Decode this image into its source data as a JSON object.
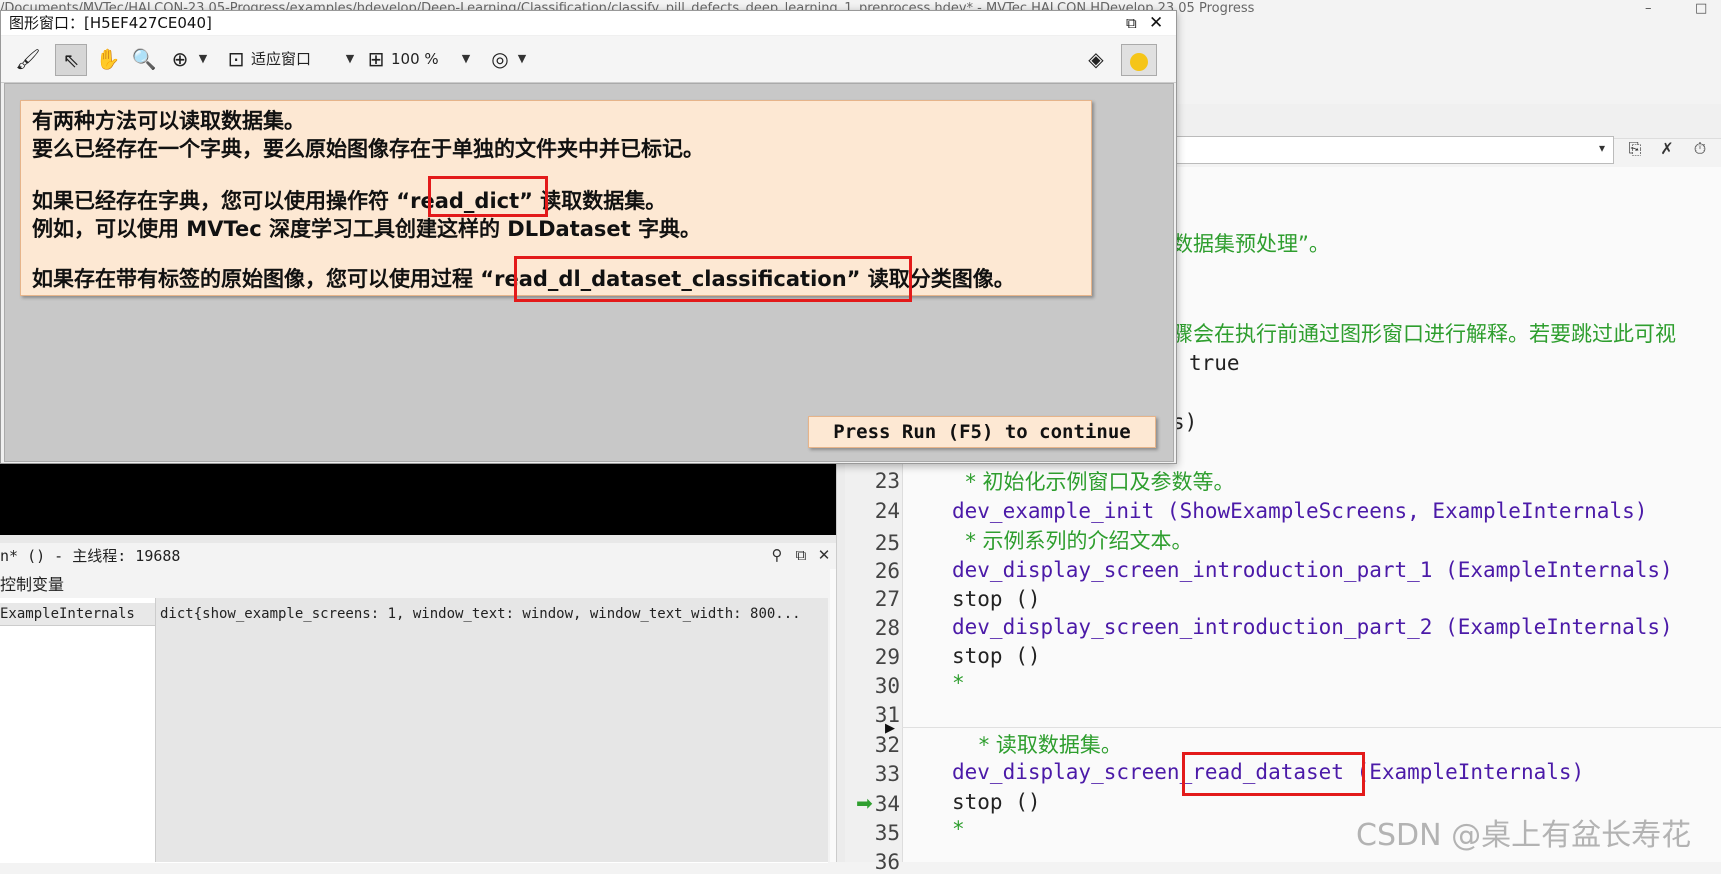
{
  "app": {
    "title": "/Documents/MVTec/HALCON-23.05-Progress/examples/hdevelop/Deep-Learning/Classification/classify_pill_defects_deep_learning_1_preprocess.hdev* - MVTec HALCON HDevelop 23.05 Progress",
    "minimize": "–",
    "close": "□"
  },
  "graphics_window": {
    "title": "图形窗口：[H5EF427CE040]",
    "restore_icon": "⧉",
    "close_icon": "✕",
    "toolbar": {
      "fit_label": "适应窗口",
      "zoom_label": "100 %"
    },
    "message_lines": [
      "有两种方法可以读取数据集。",
      "要么已经存在一个字典，要么原始图像存在于单独的文件夹中并已标记。",
      "如果已经存在字典，您可以使用操作符 “read_dict” 读取数据集。",
      "例如，可以使用 MVTec 深度学习工具创建这样的 DLDataset 字典。",
      "如果存在带有标签的原始图像，您可以使用过程 “read_dl_dataset_classification” 读取分类图像。"
    ],
    "continue_text": "Press Run (F5) to continue"
  },
  "variables": {
    "header": "n* () - 主线程: 19688",
    "tab_label": "控制变量",
    "name": "ExampleInternals",
    "value": "dict{show_example_screens: 1, window_text: window, window_text_width: 800..."
  },
  "code": {
    "partial_lines": [
      {
        "text": "数据集预处理”。",
        "color": "green"
      },
      {
        "text": "骤会在执行前通过图形窗口进行解释。若要跳过此可视",
        "color": "green"
      },
      {
        "text": "true",
        "color": "dark"
      },
      {
        "text": "s)",
        "color": "dark"
      }
    ],
    "lines": [
      {
        "num": "23",
        "text": "  * 初始化示例窗口及参数等。",
        "color": "green"
      },
      {
        "num": "24",
        "text": "dev_example_init (ShowExampleScreens, ExampleInternals)",
        "color": "purple"
      },
      {
        "num": "25",
        "text": "  * 示例系列的介绍文本。",
        "color": "green"
      },
      {
        "num": "26",
        "text": "dev_display_screen_introduction_part_1 (ExampleInternals)",
        "color": "purple"
      },
      {
        "num": "27",
        "text": "stop ()",
        "color": "dark"
      },
      {
        "num": "28",
        "text": "dev_display_screen_introduction_part_2 (ExampleInternals)",
        "color": "purple"
      },
      {
        "num": "29",
        "text": "stop ()",
        "color": "dark"
      },
      {
        "num": "30",
        "text": "*",
        "color": "green"
      },
      {
        "num": "31",
        "text": "",
        "color": "dark"
      },
      {
        "num": "32",
        "text": "    * 读取数据集。",
        "color": "green"
      },
      {
        "num": "33",
        "text": "dev_display_screen_read_dataset (ExampleInternals)",
        "color": "purple"
      },
      {
        "num": "34",
        "text": "stop ()",
        "color": "dark"
      },
      {
        "num": "35",
        "text": "*",
        "color": "green"
      },
      {
        "num": "36",
        "text": "",
        "color": "dark"
      }
    ]
  },
  "watermark": "CSDN @桌上有盆长寿花",
  "colors": {
    "highlight": "#e31a1a",
    "message_bg": "#fde8d3",
    "keyword": "#4b1aa8",
    "comment": "#2e9e2e"
  }
}
